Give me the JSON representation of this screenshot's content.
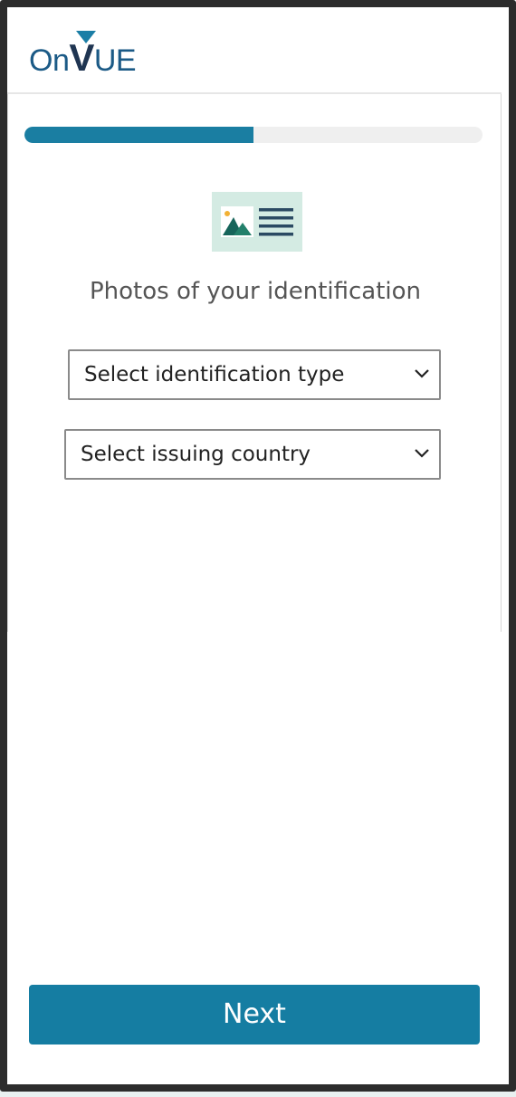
{
  "app": {
    "logo_text_prefix": "On",
    "logo_text_v": "V",
    "logo_text_suffix": "UE",
    "brand_colors": {
      "primary": "#157da2",
      "logo_blue": "#1b5a86",
      "logo_navy": "#1f3552"
    }
  },
  "progress": {
    "value_percent": 50
  },
  "illustration": {
    "icon": "id-card-photo-icon"
  },
  "page": {
    "title": "Photos of your identification"
  },
  "form": {
    "id_type_select": {
      "selected": "Select identification type",
      "icon": "chevron-down-icon"
    },
    "country_select": {
      "selected": "Select issuing country",
      "icon": "chevron-down-icon"
    }
  },
  "actions": {
    "next_label": "Next"
  }
}
